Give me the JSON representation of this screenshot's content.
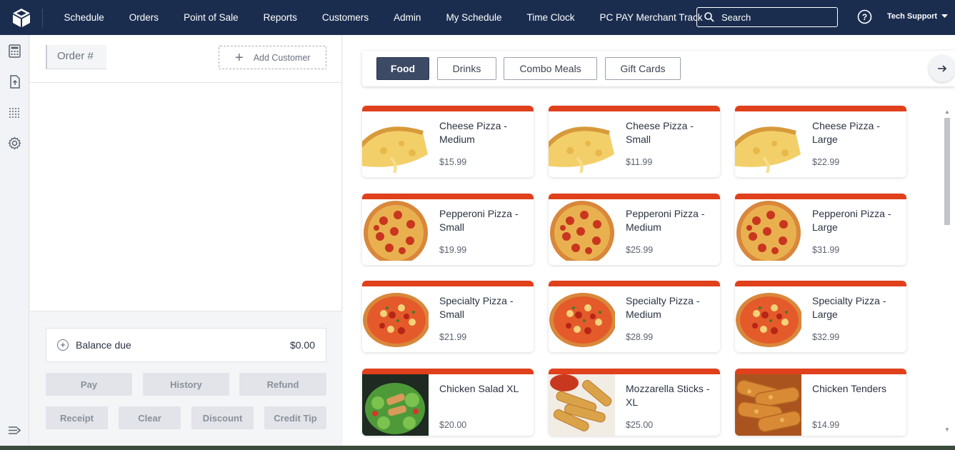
{
  "nav": {
    "items": [
      "Schedule",
      "Orders",
      "Point of Sale",
      "Reports",
      "Customers",
      "Admin",
      "My Schedule",
      "Time Clock",
      "PC PAY Merchant Track"
    ],
    "search_placeholder": "Search",
    "user": "Tech Support"
  },
  "order": {
    "order_label": "Order #",
    "add_customer": "Add Customer",
    "balance_label": "Balance due",
    "balance_value": "$0.00",
    "buttons": {
      "pay": "Pay",
      "history": "History",
      "refund": "Refund",
      "receipt": "Receipt",
      "clear": "Clear",
      "discount": "Discount",
      "credit_tip": "Credit Tip"
    }
  },
  "categories": [
    "Food",
    "Drinks",
    "Combo Meals",
    "Gift Cards"
  ],
  "active_category": "Food",
  "accent_color": "#e0401b",
  "nav_color": "#1b2d4f",
  "items": [
    {
      "name": "Cheese Pizza - Medium",
      "price": "$15.99",
      "image": "cheese-pizza"
    },
    {
      "name": "Cheese Pizza - Small",
      "price": "$11.99",
      "image": "cheese-pizza"
    },
    {
      "name": "Cheese Pizza - Large",
      "price": "$22.99",
      "image": "cheese-pizza"
    },
    {
      "name": "Pepperoni Pizza - Small",
      "price": "$19.99",
      "image": "pepperoni-pizza"
    },
    {
      "name": "Pepperoni Pizza - Medium",
      "price": "$25.99",
      "image": "pepperoni-pizza"
    },
    {
      "name": "Pepperoni Pizza - Large",
      "price": "$31.99",
      "image": "pepperoni-pizza"
    },
    {
      "name": "Specialty Pizza - Small",
      "price": "$21.99",
      "image": "specialty-pizza"
    },
    {
      "name": "Specialty Pizza - Medium",
      "price": "$28.99",
      "image": "specialty-pizza"
    },
    {
      "name": "Specialty Pizza - Large",
      "price": "$32.99",
      "image": "specialty-pizza"
    },
    {
      "name": "Chicken Salad XL",
      "price": "$20.00",
      "image": "chicken-salad"
    },
    {
      "name": "Mozzarella Sticks - XL",
      "price": "$25.00",
      "image": "mozzarella-sticks"
    },
    {
      "name": "Chicken Tenders",
      "price": "$14.99",
      "image": "chicken-tenders"
    }
  ]
}
